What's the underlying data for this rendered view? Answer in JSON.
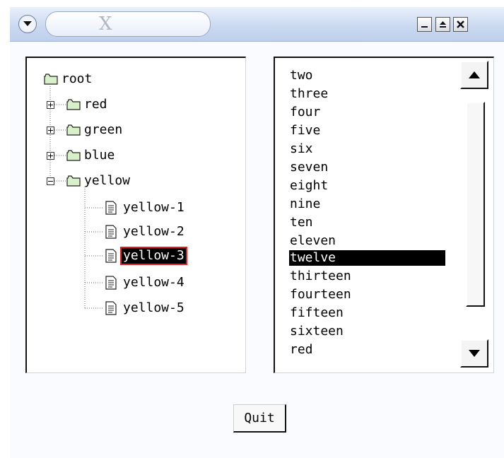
{
  "window": {
    "title": "X",
    "controls": [
      "minimize-icon",
      "maximize-icon",
      "close-icon"
    ]
  },
  "tree": {
    "root": "root",
    "nodes": [
      {
        "label": "red",
        "state": "collapsed"
      },
      {
        "label": "green",
        "state": "collapsed"
      },
      {
        "label": "blue",
        "state": "collapsed"
      },
      {
        "label": "yellow",
        "state": "expanded"
      }
    ],
    "children": [
      "yellow-1",
      "yellow-2",
      "yellow-3",
      "yellow-4",
      "yellow-5"
    ],
    "selected": "yellow-3"
  },
  "list": {
    "items": [
      "two",
      "three",
      "four",
      "five",
      "six",
      "seven",
      "eight",
      "nine",
      "ten",
      "eleven",
      "twelve",
      "thirteen",
      "fourteen",
      "fifteen",
      "sixteen",
      "red"
    ],
    "selected": "twelve"
  },
  "quit_label": "Quit",
  "colors": {
    "selection_bg": "#000000",
    "selection_outline": "#e02020",
    "folder_fill": "#d8f0c8"
  }
}
